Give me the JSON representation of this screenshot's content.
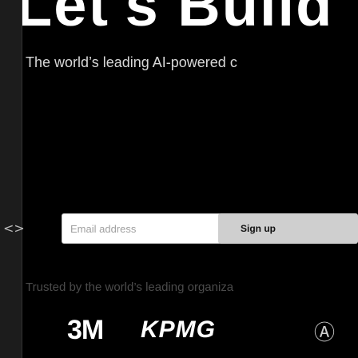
{
  "hero": {
    "title": "Let's Build"
  },
  "subtitle": "The world’s leading AI-powered c",
  "nav": {
    "code_icon": "code-icon",
    "code_glyph": "<>"
  },
  "form": {
    "email_placeholder": "Email address",
    "signup_label": "Sign up"
  },
  "trusted": "Trusted by the world’s leading organiza",
  "logos": {
    "three_m": "3M",
    "kpmg": "KPMG",
    "seal": "Ⓐ"
  }
}
